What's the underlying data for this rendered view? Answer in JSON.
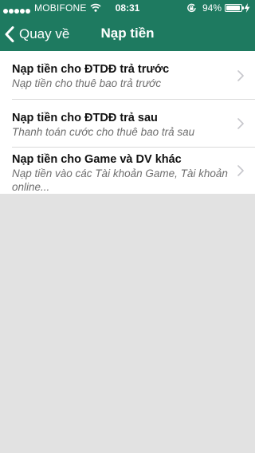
{
  "status_bar": {
    "carrier": "MOBIFONE",
    "time": "08:31",
    "battery_percent": "94%",
    "battery_level": 0.94,
    "signal_bars": 5
  },
  "nav": {
    "back_label": "Quay về",
    "title": "Nạp tiền"
  },
  "menu": {
    "items": [
      {
        "title": "Nạp tiền cho ĐTDĐ trả trước",
        "subtitle": "Nạp tiền cho thuê bao trả trước"
      },
      {
        "title": "Nạp tiền cho ĐTDĐ trả sau",
        "subtitle": "Thanh toán cước cho thuê bao trả sau"
      },
      {
        "title": "Nạp tiền cho Game và DV khác",
        "subtitle": "Nạp tiền vào các Tài khoản Game, Tài khoản online..."
      }
    ]
  },
  "colors": {
    "header_bg": "#1e7a60",
    "page_bg": "#e2e2e2",
    "list_bg": "#ffffff",
    "chevron": "#c7c7cc"
  },
  "icons": {
    "back": "chevron-left-icon",
    "row_arrow": "chevron-right-icon",
    "wifi": "wifi-icon",
    "orientation_lock": "rotation-lock-icon",
    "battery": "battery-icon",
    "charging": "charging-bolt-icon"
  }
}
